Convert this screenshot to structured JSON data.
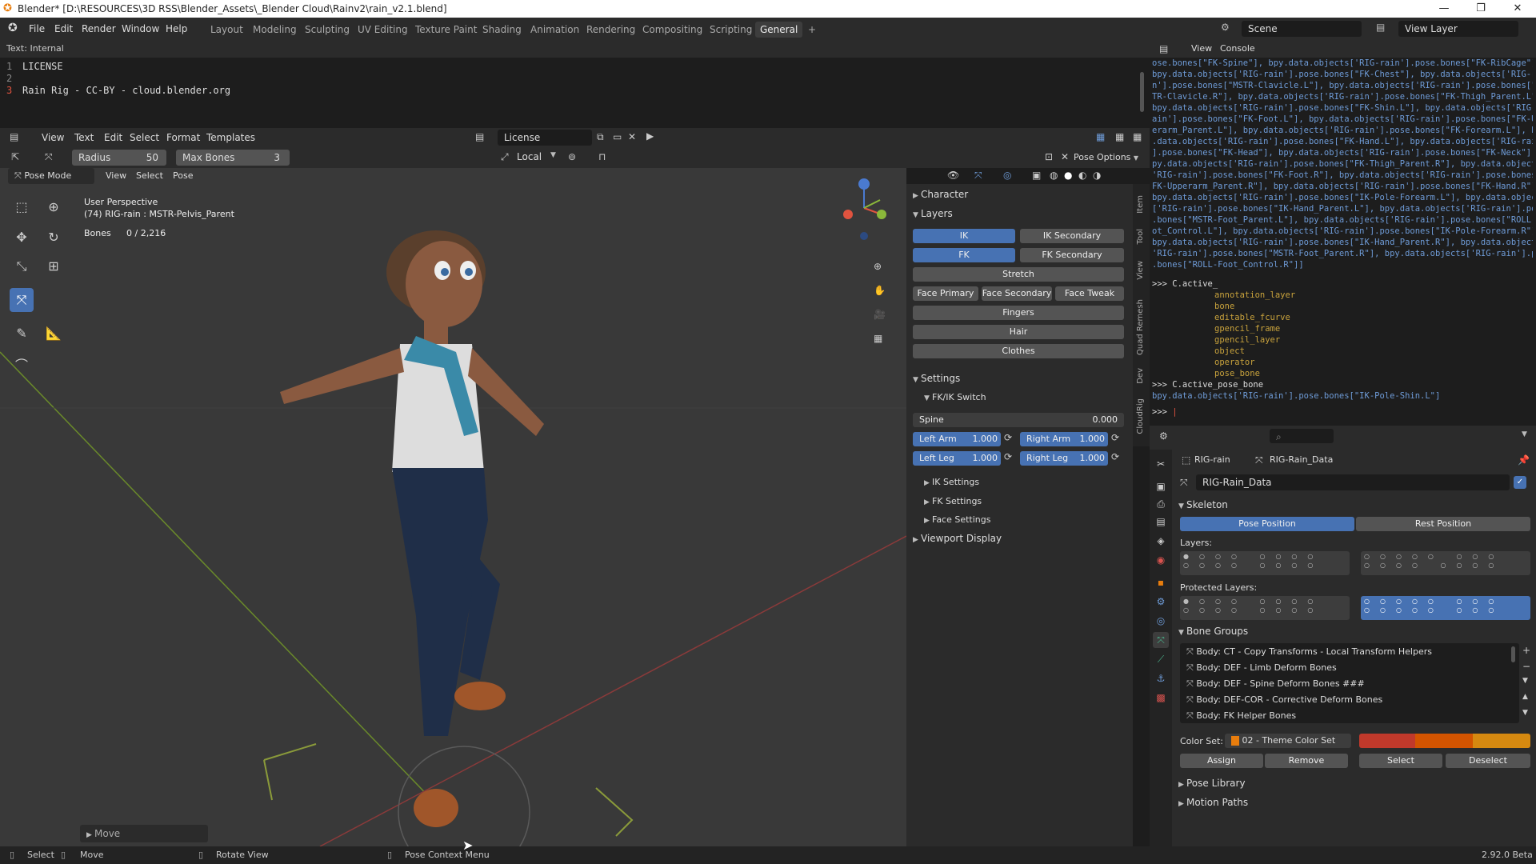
{
  "window": {
    "title": "Blender* [D:\\RESOURCES\\3D RSS\\Blender_Assets\\_Blender Cloud\\Rainv2\\rain_v2.1.blend]",
    "min": "—",
    "max": "❐",
    "close": "✕"
  },
  "menu": [
    "File",
    "Edit",
    "Render",
    "Window",
    "Help"
  ],
  "workspaces": [
    "Layout",
    "Modeling",
    "Sculpting",
    "UV Editing",
    "Texture Paint",
    "Shading",
    "Animation",
    "Rendering",
    "Compositing",
    "Scripting",
    "General",
    "+"
  ],
  "scene": "Scene",
  "view_layer": "View Layer",
  "text_editor": {
    "label": "Text: Internal",
    "lines": [
      {
        "n": "1",
        "t": "LICENSE"
      },
      {
        "n": "2",
        "t": ""
      },
      {
        "n": "3",
        "t": "Rain Rig - CC-BY - cloud.blender.org"
      }
    ],
    "menus": [
      "View",
      "Text",
      "Edit",
      "Select",
      "Format",
      "Templates"
    ],
    "file": "License"
  },
  "tool_header": {
    "radius_label": "Radius",
    "radius_value": "50",
    "maxbones_label": "Max Bones",
    "maxbones_value": "3",
    "orientation": "Local",
    "pose_options": "Pose Options"
  },
  "viewport_header": {
    "mode": "Pose Mode",
    "menus": [
      "View",
      "Select",
      "Pose"
    ]
  },
  "overlay": {
    "perspective": "User Perspective",
    "object": "(74) RIG-rain : MSTR-Pelvis_Parent",
    "bones_label": "Bones",
    "bones_value": "0 / 2,216"
  },
  "operator_panel": "Move",
  "npanel": {
    "character": "Character",
    "layers": "Layers",
    "layer_buttons": [
      {
        "label": "IK",
        "on": true
      },
      {
        "label": "IK Secondary",
        "on": false
      },
      {
        "label": "FK",
        "on": true
      },
      {
        "label": "FK Secondary",
        "on": false
      }
    ],
    "stretch": "Stretch",
    "face": [
      "Face Primary",
      "Face Secondary",
      "Face Tweak"
    ],
    "fingers": "Fingers",
    "hair": "Hair",
    "clothes": "Clothes",
    "settings": "Settings",
    "fkik": "FK/IK Switch",
    "spine_label": "Spine",
    "spine_value": "0.000",
    "limbs": [
      {
        "label": "Left Arm",
        "value": "1.000"
      },
      {
        "label": "Right Arm",
        "value": "1.000"
      },
      {
        "label": "Left Leg",
        "value": "1.000"
      },
      {
        "label": "Right Leg",
        "value": "1.000"
      }
    ],
    "subs": [
      "IK Settings",
      "FK Settings",
      "Face Settings"
    ],
    "viewport_display": "Viewport Display",
    "tabs": [
      "Item",
      "Tool",
      "View",
      "Quad Remesh",
      "Dev",
      "CloudRig"
    ]
  },
  "console": {
    "menus": [
      "View",
      "Console"
    ],
    "output": [
      "ose.bones[\"FK-Spine\"], bpy.data.objects['RIG-rain'].pose.bones[\"FK-RibCage\"]",
      "bpy.data.objects['RIG-rain'].pose.bones[\"FK-Chest\"], bpy.data.objects['RIG-rai",
      "n'].pose.bones[\"MSTR-Clavicle.L\"], bpy.data.objects['RIG-rain'].pose.bones[\"MS",
      "TR-Clavicle.R\"], bpy.data.objects['RIG-rain'].pose.bones[\"FK-Thigh_Parent.L\"],",
      " bpy.data.objects['RIG-rain'].pose.bones[\"FK-Shin.L\"], bpy.data.objects['RIG-r",
      "ain'].pose.bones[\"FK-Foot.L\"], bpy.data.objects['RIG-rain'].pose.bones[\"FK-Upp",
      "erarm_Parent.L\"], bpy.data.objects['RIG-rain'].pose.bones[\"FK-Forearm.L\"], bpy",
      ".data.objects['RIG-rain'].pose.bones[\"FK-Hand.L\"], bpy.data.objects['RIG-rain'",
      "].pose.bones[\"FK-Head\"], bpy.data.objects['RIG-rain'].pose.bones[\"FK-Neck\"], b",
      "py.data.objects['RIG-rain'].pose.bones[\"FK-Thigh_Parent.R\"], bpy.data.objects[",
      "'RIG-rain'].pose.bones[\"FK-Foot.R\"], bpy.data.objects['RIG-rain'].pose.bones[\"",
      "FK-Upperarm_Parent.R\"], bpy.data.objects['RIG-rain'].pose.bones[\"FK-Hand.R\"],",
      " bpy.data.objects['RIG-rain'].pose.bones[\"IK-Pole-Forearm.L\"], bpy.data.objects",
      "['RIG-rain'].pose.bones[\"IK-Hand_Parent.L\"], bpy.data.objects['RIG-rain'].pose",
      ".bones[\"MSTR-Foot_Parent.L\"], bpy.data.objects['RIG-rain'].pose.bones[\"ROLL-Fo",
      "ot_Control.L\"], bpy.data.objects['RIG-rain'].pose.bones[\"IK-Pole-Forearm.R\"],",
      " bpy.data.objects['RIG-rain'].pose.bones[\"IK-Hand_Parent.R\"], bpy.data.objects[",
      "'RIG-rain'].pose.bones[\"MSTR-Foot_Parent.R\"], bpy.data.objects['RIG-rain'].pose",
      ".bones[\"ROLL-Foot_Control.R\"]]"
    ],
    "prompt1": ">>> C.active_",
    "completions": [
      "annotation_layer",
      "bone",
      "editable_fcurve",
      "gpencil_frame",
      "gpencil_layer",
      "object",
      "operator",
      "pose_bone"
    ],
    "prompt2": ">>> C.active_pose_bone",
    "result": "bpy.data.objects['RIG-rain'].pose.bones[\"IK-Pole-Shin.L\"]",
    "prompt3": ">>> "
  },
  "props": {
    "obj": "RIG-rain",
    "data": "RIG-Rain_Data",
    "data_field": "RIG-Rain_Data",
    "skeleton": "Skeleton",
    "pose_position": "Pose Position",
    "rest_position": "Rest Position",
    "layers": "Layers:",
    "protected_layers": "Protected Layers:",
    "bone_groups": "Bone Groups",
    "groups": [
      "Body: CT - Copy Transforms - Local Transform Helpers",
      "Body: DEF - Limb Deform Bones",
      "Body: DEF - Spine Deform Bones ###",
      "Body: DEF-COR - Corrective Deform Bones",
      "Body: FK Helper Bones"
    ],
    "color_set_label": "Color Set:",
    "color_set": "02 - Theme Color Set",
    "color_swatches": [
      "#c0392b",
      "#d35400",
      "#d68910"
    ],
    "buttons": [
      "Assign",
      "Remove",
      "Select",
      "Deselect"
    ],
    "pose_library": "Pose Library",
    "motion_paths": "Motion Paths"
  },
  "status": {
    "select": "Select",
    "move": "Move",
    "rotate": "Rotate View",
    "context": "Pose Context Menu",
    "version": "2.92.0 Beta"
  }
}
